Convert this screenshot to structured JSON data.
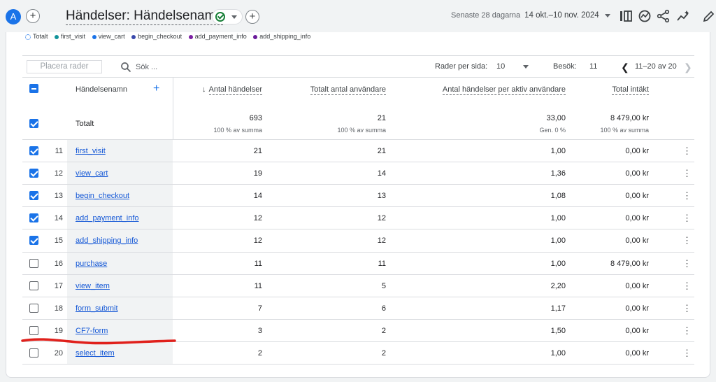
{
  "header": {
    "avatar_letter": "A",
    "title": "Händelser: Händelsenamn",
    "date_label": "Senaste 28 dagarna",
    "date_range": "14 okt.–10 nov. 2024"
  },
  "legend": [
    "Totalt",
    "first_visit",
    "view_cart",
    "begin_checkout",
    "add_payment_info",
    "add_shipping_info"
  ],
  "legend_colors": [
    "#1a73e8",
    "#12939a",
    "#1a73e8",
    "#3949ab",
    "#7b1fa2",
    "#6a1b9a"
  ],
  "controls": {
    "place_rows_placeholder": "Placera rader",
    "search_placeholder": "Sök ...",
    "rows_per_page_label": "Rader per sida:",
    "rows_per_page_value": "10",
    "visits_label": "Besök:",
    "visits_value": "11",
    "pagination": "11–20 av 20"
  },
  "table": {
    "headers": {
      "dimension": "Händelsenamn",
      "event_count": "Antal händelser",
      "total_users": "Totalt antal användare",
      "events_per_user": "Antal händelser per aktiv användare",
      "total_revenue": "Total intäkt"
    },
    "totals": {
      "label": "Totalt",
      "event_count": "693",
      "event_count_sub": "100 % av summa",
      "total_users": "21",
      "total_users_sub": "100 % av summa",
      "events_per_user": "33,00",
      "events_per_user_sub": "Gen. 0 %",
      "total_revenue": "8 479,00 kr",
      "total_revenue_sub": "100 % av summa"
    },
    "rows": [
      {
        "idx": "11",
        "name": "first_visit",
        "checked": true,
        "events": "21",
        "users": "21",
        "per_user": "1,00",
        "revenue": "0,00 kr"
      },
      {
        "idx": "12",
        "name": "view_cart",
        "checked": true,
        "events": "19",
        "users": "14",
        "per_user": "1,36",
        "revenue": "0,00 kr"
      },
      {
        "idx": "13",
        "name": "begin_checkout",
        "checked": true,
        "events": "14",
        "users": "13",
        "per_user": "1,08",
        "revenue": "0,00 kr"
      },
      {
        "idx": "14",
        "name": "add_payment_info",
        "checked": true,
        "events": "12",
        "users": "12",
        "per_user": "1,00",
        "revenue": "0,00 kr"
      },
      {
        "idx": "15",
        "name": "add_shipping_info",
        "checked": true,
        "events": "12",
        "users": "12",
        "per_user": "1,00",
        "revenue": "0,00 kr"
      },
      {
        "idx": "16",
        "name": "purchase",
        "checked": false,
        "events": "11",
        "users": "11",
        "per_user": "1,00",
        "revenue": "8 479,00 kr"
      },
      {
        "idx": "17",
        "name": "view_item",
        "checked": false,
        "events": "11",
        "users": "5",
        "per_user": "2,20",
        "revenue": "0,00 kr"
      },
      {
        "idx": "18",
        "name": "form_submit",
        "checked": false,
        "events": "7",
        "users": "6",
        "per_user": "1,17",
        "revenue": "0,00 kr"
      },
      {
        "idx": "19",
        "name": "CF7-form",
        "checked": false,
        "events": "3",
        "users": "2",
        "per_user": "1,50",
        "revenue": "0,00 kr"
      },
      {
        "idx": "20",
        "name": "select_item",
        "checked": false,
        "events": "2",
        "users": "2",
        "per_user": "1,00",
        "revenue": "0,00 kr"
      }
    ]
  },
  "colors": {
    "accent": "#1a73e8",
    "annotation": "#e0201b"
  }
}
